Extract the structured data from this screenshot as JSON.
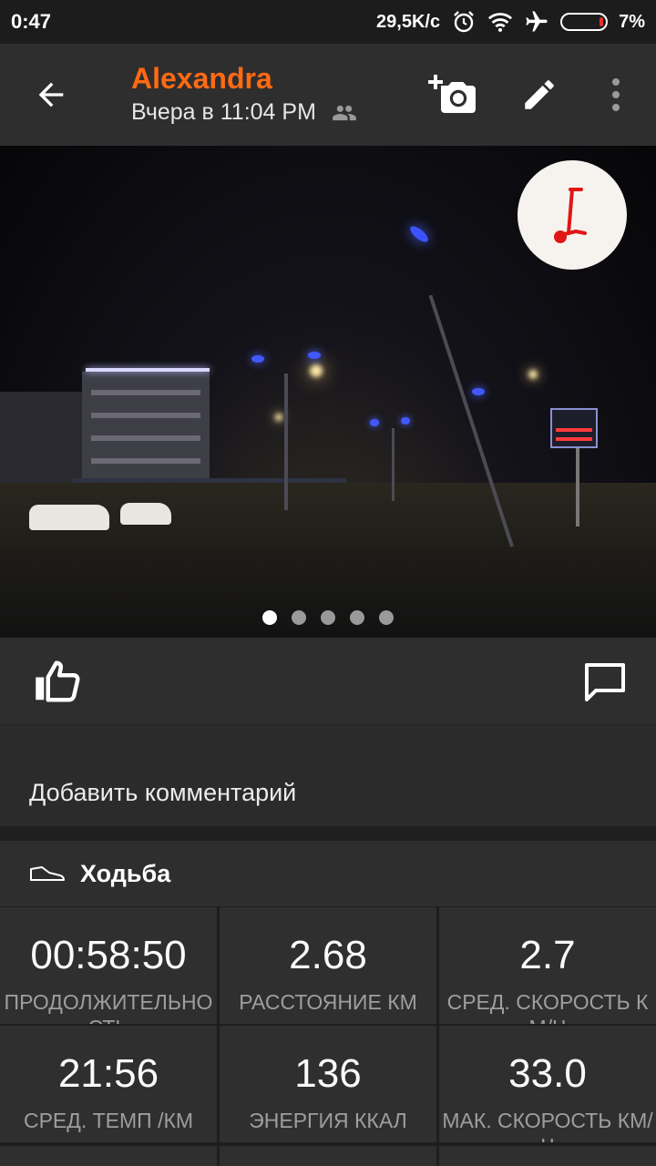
{
  "status_bar": {
    "time": "0:47",
    "net_speed": "29,5K/c",
    "battery": "7%",
    "icons": [
      "alarm-icon",
      "wifi-icon",
      "airplane-icon",
      "battery-icon"
    ]
  },
  "header": {
    "name": "Alexandra",
    "subtitle": "Вчера в 11:04 PM",
    "name_color": "#ff6a13"
  },
  "photo": {
    "page_count": 5,
    "active_page": 1
  },
  "comment": {
    "placeholder": "Добавить комментарий"
  },
  "activity": {
    "type": "Ходьба"
  },
  "stats": [
    {
      "value": "00:58:50",
      "label": "ПРОДОЛЖИТЕЛЬНОСТЬ"
    },
    {
      "value": "2.68",
      "label": "РАССТОЯНИЕ КМ"
    },
    {
      "value": "2.7",
      "label": "СРЕД. СКОРОСТЬ КМ/Ч"
    },
    {
      "value": "21:56",
      "label": "СРЕД. ТЕМП /КМ"
    },
    {
      "value": "136",
      "label": "ЭНЕРГИЯ ККАЛ"
    },
    {
      "value": "33.0",
      "label": "МАК. СКОРОСТЬ КМ/Ч"
    }
  ]
}
